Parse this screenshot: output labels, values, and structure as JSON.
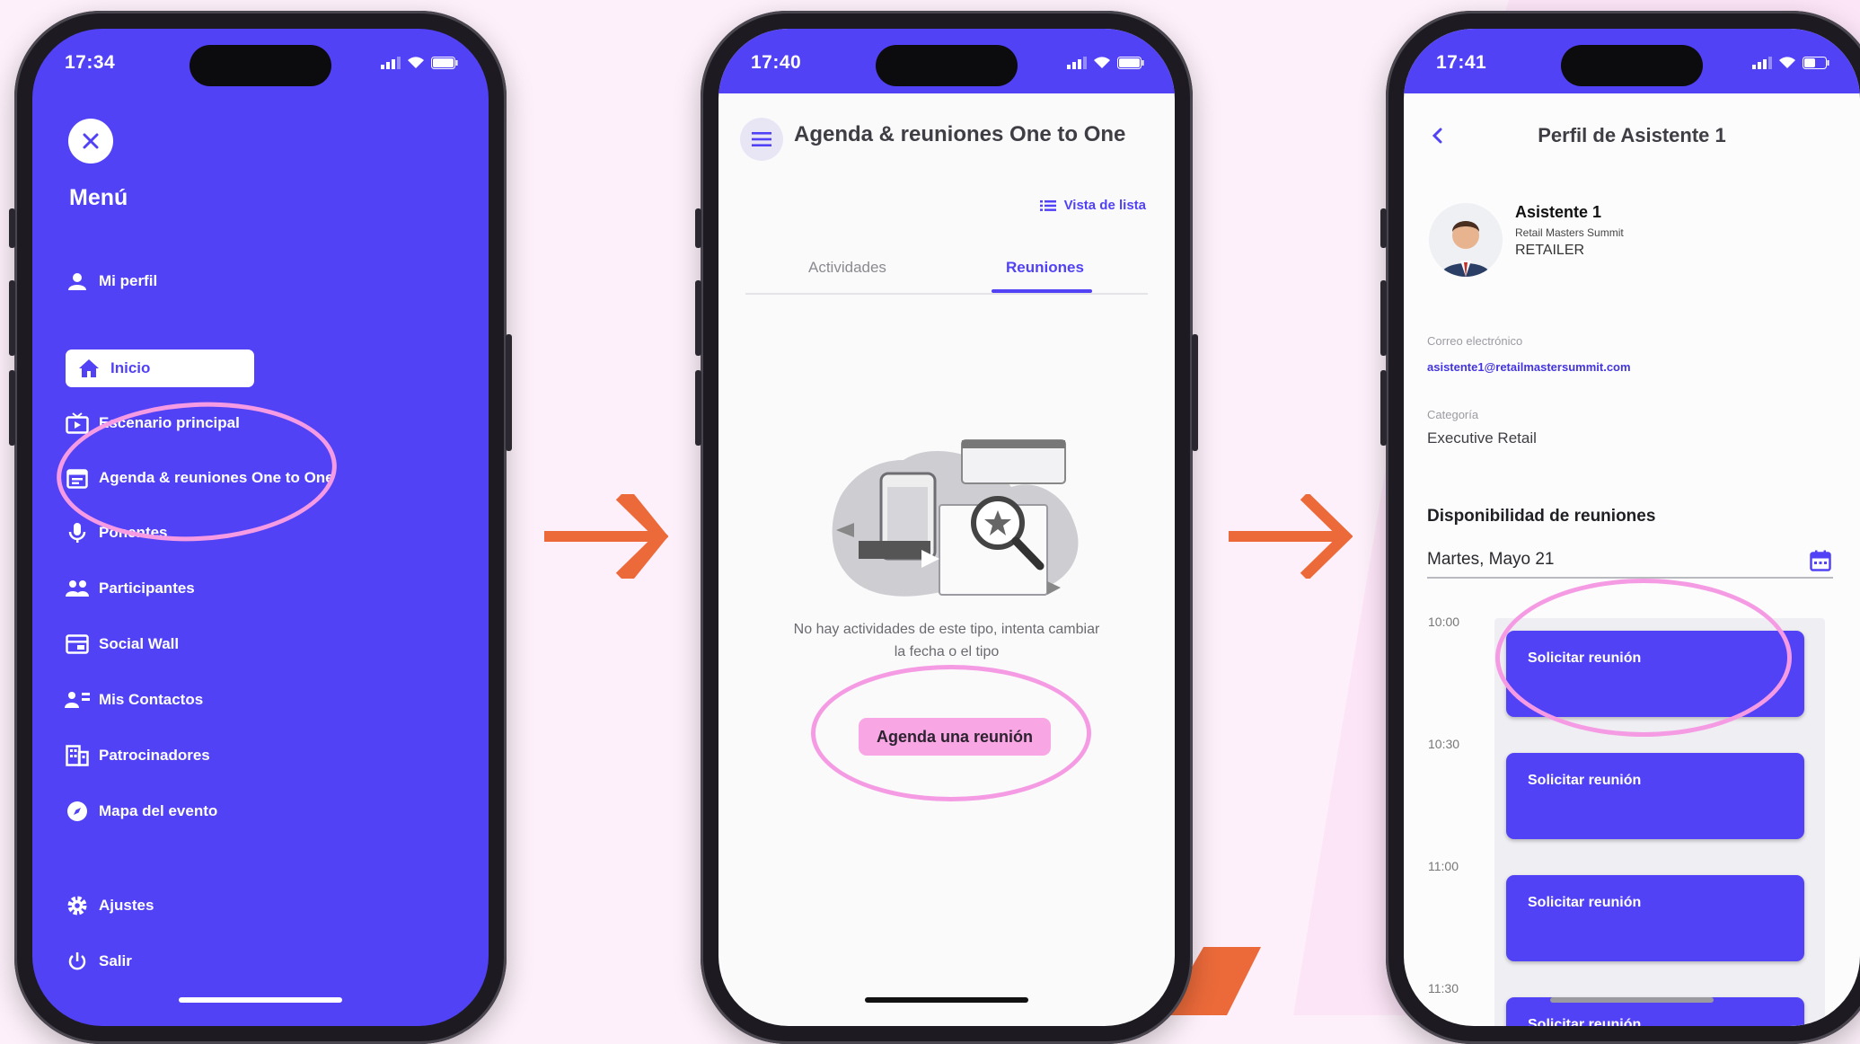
{
  "colors": {
    "brand": "#5242f5",
    "highlight": "#f59be4",
    "arrow": "#ec6a3a",
    "background": "#fdf0fa"
  },
  "phone1": {
    "time": "17:34",
    "menu_title": "Menú",
    "items": [
      {
        "label": "Mi perfil",
        "icon": "person-icon"
      },
      {
        "label": "Inicio",
        "icon": "home-icon"
      },
      {
        "label": "Escenario principal",
        "icon": "tv-icon"
      },
      {
        "label": "Agenda & reuniones One to One",
        "icon": "calendar-icon"
      },
      {
        "label": "Ponentes",
        "icon": "microphone-icon"
      },
      {
        "label": "Participantes",
        "icon": "people-icon"
      },
      {
        "label": "Social Wall",
        "icon": "wall-icon"
      },
      {
        "label": "Mis Contactos",
        "icon": "contacts-icon"
      },
      {
        "label": "Patrocinadores",
        "icon": "building-icon"
      },
      {
        "label": "Mapa del evento",
        "icon": "compass-icon"
      },
      {
        "label": "Ajustes",
        "icon": "gear-icon"
      },
      {
        "label": "Salir",
        "icon": "power-icon"
      }
    ]
  },
  "phone2": {
    "time": "17:40",
    "title": "Agenda & reuniones One to One",
    "view_toggle": "Vista de lista",
    "tabs": [
      "Actividades",
      "Reuniones"
    ],
    "active_tab": "Reuniones",
    "empty_line1": "No hay actividades de este tipo, intenta cambiar",
    "empty_line2": "la fecha o el tipo",
    "cta": "Agenda una reunión"
  },
  "phone3": {
    "time": "17:41",
    "title": "Perfil de Asistente 1",
    "name": "Asistente 1",
    "organization": "Retail Masters Summit",
    "role": "RETAILER",
    "email_label": "Correo electrónico",
    "email": "asistente1@retailmastersummit.com",
    "category_label": "Categoría",
    "category": "Executive Retail",
    "availability_title": "Disponibilidad de reuniones",
    "date": "Martes, Mayo 21",
    "times": [
      "10:00",
      "10:30",
      "11:00",
      "11:30"
    ],
    "slot_label": "Solicitar reunión"
  }
}
